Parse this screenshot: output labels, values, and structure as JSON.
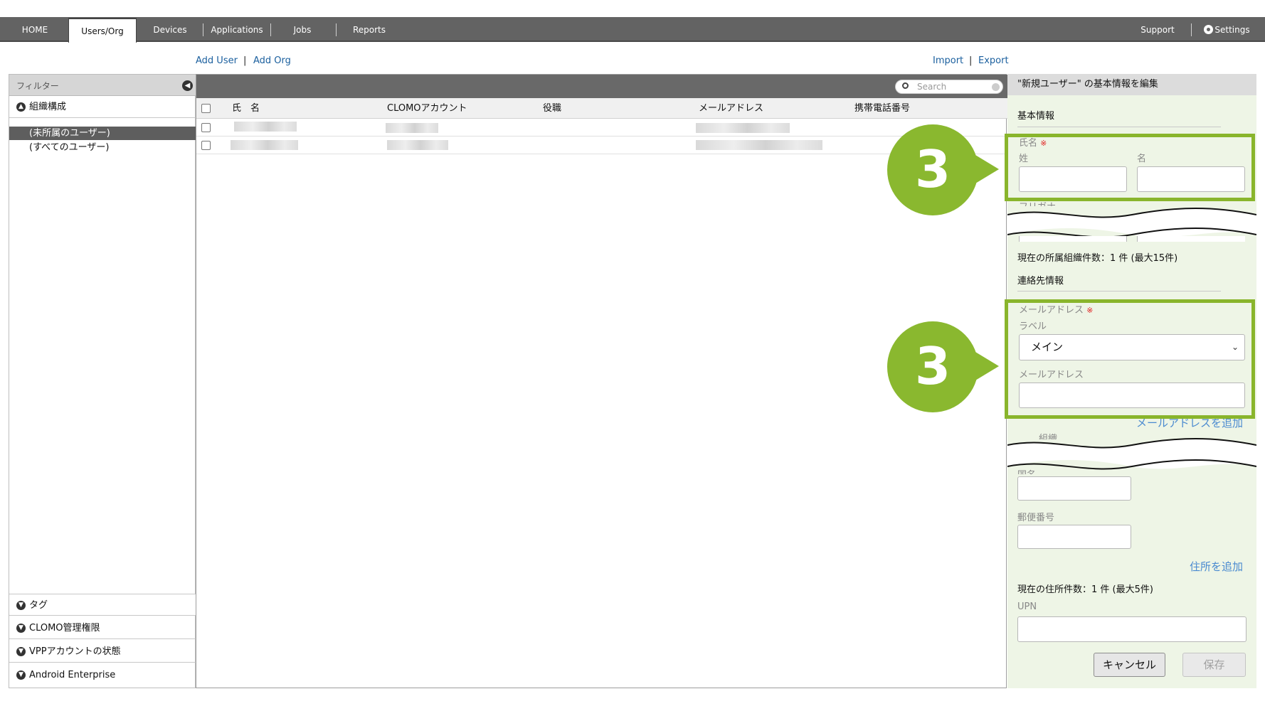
{
  "nav": {
    "tabs": [
      {
        "label": "HOME"
      },
      {
        "label": "Users/Org"
      },
      {
        "label": "Devices"
      },
      {
        "label": "Applications"
      },
      {
        "label": "Jobs"
      },
      {
        "label": "Reports"
      }
    ],
    "support": "Support",
    "settings": "Settings"
  },
  "sublinks": {
    "add_user": "Add User",
    "sep": "|",
    "add_org": "Add Org",
    "import": "Import",
    "export": "Export"
  },
  "filter": {
    "title": "フィルター",
    "org_section": "組織構成",
    "items": [
      "(未所属のユーザー)",
      "(すべてのユーザー)"
    ],
    "bottom_sections": [
      "タグ",
      "CLOMO管理権限",
      "VPPアカウントの状態",
      "Android Enterprise"
    ]
  },
  "table": {
    "search_placeholder": "Search",
    "columns": [
      "氏　名",
      "CLOMOアカウント",
      "役職",
      "メールアドレス",
      "携帯電話番号"
    ]
  },
  "form": {
    "header": "\"新規ユーザー\" の基本情報を編集",
    "basic_info": "基本情報",
    "name_label": "氏名",
    "req_mark": "※",
    "last_name": "姓",
    "first_name": "名",
    "furigana_partial": "フリガナ",
    "org_count": "現在の所属組織件数：1 件 (最大15件)",
    "contact_info": "連絡先情報",
    "email_label": "メールアドレス",
    "label_label": "ラベル",
    "label_value": "メイン",
    "email_sublabel": "メールアドレス",
    "add_email": "メールアドレスを追加",
    "org_partial": "組織",
    "country_partial": "国名",
    "postal_label": "郵便番号",
    "add_address": "住所を追加",
    "address_count": "現在の住所件数：1 件 (最大5件)",
    "upn_label": "UPN",
    "cancel": "キャンセル",
    "save": "保存"
  },
  "callouts": [
    "3",
    "3"
  ]
}
